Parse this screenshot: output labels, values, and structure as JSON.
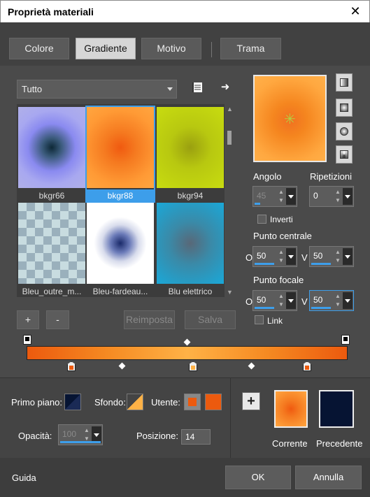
{
  "window": {
    "title": "Proprietà materiali",
    "close_glyph": "✕"
  },
  "tabs": [
    {
      "label": "Colore",
      "active": false
    },
    {
      "label": "Gradiente",
      "active": true
    },
    {
      "label": "Motivo",
      "active": false
    },
    {
      "label": "Trama",
      "active": false
    }
  ],
  "filter": {
    "selected": "Tutto"
  },
  "gallery": {
    "items": [
      {
        "label": "bkgr66",
        "selected": false
      },
      {
        "label": "bkgr88",
        "selected": true
      },
      {
        "label": "bkgr94",
        "selected": false
      },
      {
        "label": "Bleu_outre_m...",
        "selected": false
      },
      {
        "label": "Bleu-fardeau...",
        "selected": false
      },
      {
        "label": "Blu elettrico",
        "selected": false
      }
    ]
  },
  "buttons": {
    "add": "+",
    "remove": "-",
    "reset": "Reimposta",
    "save": "Salva"
  },
  "angle": {
    "label": "Angolo",
    "value": "45",
    "enabled": false
  },
  "repeats": {
    "label": "Ripetizioni",
    "value": "0"
  },
  "invert": {
    "label": "Inverti",
    "checked": false
  },
  "center_point": {
    "label": "Punto centrale",
    "o_label": "O",
    "o_value": "50",
    "v_label": "V",
    "v_value": "50"
  },
  "focal_point": {
    "label": "Punto focale",
    "o_label": "O",
    "o_value": "50",
    "v_label": "V",
    "v_value": "50"
  },
  "link": {
    "label": "Link",
    "checked": false
  },
  "colors": {
    "foreground_label": "Primo piano:",
    "background_label": "Sfondo:",
    "user_label": "Utente:",
    "user_color": "#ec5a0e",
    "accent": "#3d9eea"
  },
  "opacity": {
    "label": "Opacità:",
    "value": "100",
    "enabled": false
  },
  "position": {
    "label": "Posizione:",
    "value": "14"
  },
  "compare": {
    "current_label": "Corrente",
    "previous_label": "Precedente",
    "previous_color": "#061433"
  },
  "footer": {
    "help": "Guida",
    "ok": "OK",
    "cancel": "Annulla"
  }
}
